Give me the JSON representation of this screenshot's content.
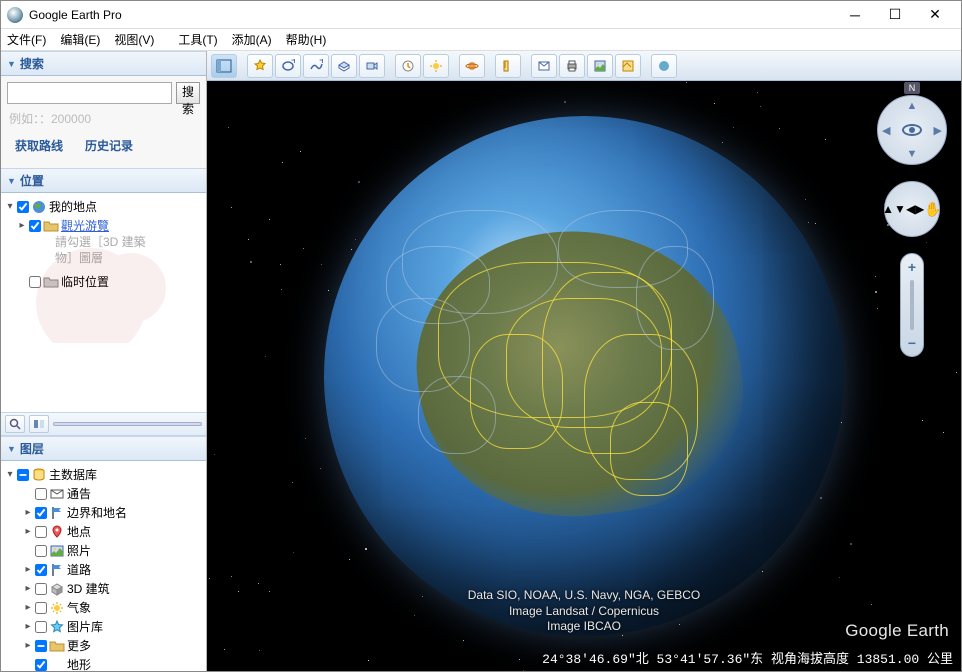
{
  "window": {
    "title": "Google Earth Pro"
  },
  "menu": {
    "file": "文件(F)",
    "edit": "编辑(E)",
    "view": "视图(V)",
    "tools": "工具(T)",
    "add": "添加(A)",
    "help": "帮助(H)"
  },
  "search": {
    "header": "搜索",
    "button": "搜索",
    "hint": "例如：：200000",
    "links": {
      "directions": "获取路线",
      "history": "历史记录"
    }
  },
  "places": {
    "header": "位置",
    "my_places": "我的地点",
    "sightseeing": "觀光游覽",
    "sub_hint1": "請勾選［3D 建築",
    "sub_hint2": "物］圖層",
    "temp": "临时位置"
  },
  "layers": {
    "header": "图层",
    "items": [
      {
        "label": "主数据库",
        "checked": "mixed",
        "icon": "db"
      },
      {
        "label": "通告",
        "checked": false,
        "icon": "mail"
      },
      {
        "label": "边界和地名",
        "checked": true,
        "icon": "flag"
      },
      {
        "label": "地点",
        "checked": false,
        "icon": "pin"
      },
      {
        "label": "照片",
        "checked": false,
        "icon": "photo"
      },
      {
        "label": "道路",
        "checked": true,
        "icon": "flag"
      },
      {
        "label": "3D 建筑",
        "checked": false,
        "icon": "cube"
      },
      {
        "label": "气象",
        "checked": false,
        "icon": "sun"
      },
      {
        "label": "图片库",
        "checked": false,
        "icon": "star"
      },
      {
        "label": "更多",
        "checked": "mixed",
        "icon": "folder"
      },
      {
        "label": "地形",
        "checked": true,
        "icon": "none"
      }
    ]
  },
  "attribution": {
    "line1": "Data SIO, NOAA, U.S. Navy, NGA, GEBCO",
    "line2": "Image Landsat / Copernicus",
    "line3": "Image IBCAO"
  },
  "status": "24°38'46.69\"北  53°41'57.36\"东 视角海拔高度 13851.00 公里",
  "watermark": "Google Earth",
  "compass_n": "N"
}
